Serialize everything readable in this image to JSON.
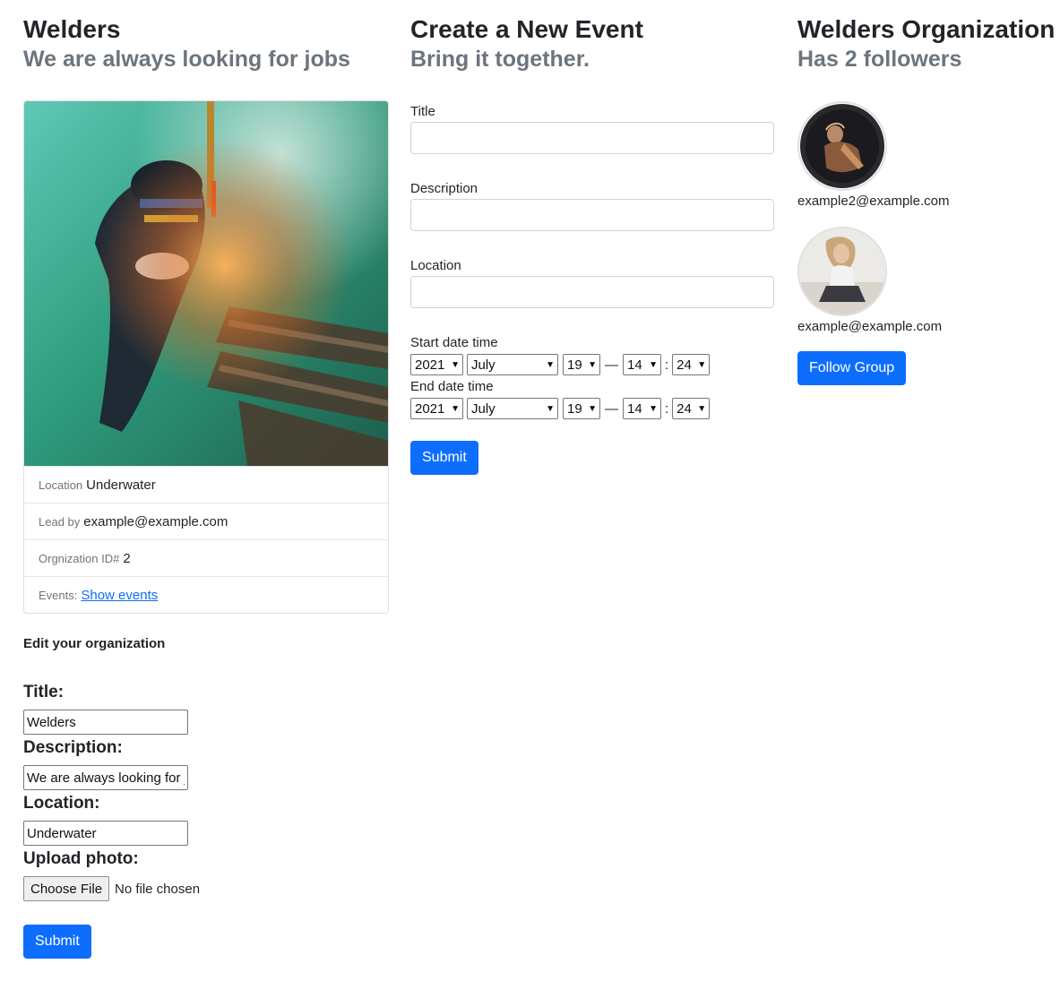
{
  "organization": {
    "title": "Welders",
    "subtitle": "We are always looking for jobs",
    "details": {
      "location_label": "Location",
      "location_value": "Underwater",
      "lead_label": "Lead by",
      "lead_value": "example@example.com",
      "org_id_label": "Orgnization ID#",
      "org_id_value": "2",
      "events_label": "Events:",
      "events_link": "Show events"
    }
  },
  "edit_form": {
    "heading": "Edit your organization",
    "title_label": "Title:",
    "title_value": "Welders",
    "description_label": "Description:",
    "description_value": "We are always looking for jobs",
    "location_label": "Location:",
    "location_value": "Underwater",
    "photo_label": "Upload photo:",
    "choose_file_label": "Choose File",
    "no_file_text": "No file chosen",
    "submit_label": "Submit"
  },
  "event_form": {
    "heading": "Create a New Event",
    "subheading": "Bring it together.",
    "title_label": "Title",
    "description_label": "Description",
    "location_label": "Location",
    "start_label": "Start date time",
    "end_label": "End date time",
    "start": {
      "year": "2021",
      "month": "July",
      "day": "19",
      "hour": "14",
      "minute": "24"
    },
    "end": {
      "year": "2021",
      "month": "July",
      "day": "19",
      "hour": "14",
      "minute": "24"
    },
    "dash": "—",
    "colon": ":",
    "submit_label": "Submit"
  },
  "group": {
    "heading": "Welders Organization",
    "followers_text": "Has 2 followers",
    "followers": [
      {
        "email": "example2@example.com"
      },
      {
        "email": "example@example.com"
      }
    ],
    "follow_label": "Follow Group"
  },
  "colors": {
    "primary": "#0d6efd",
    "muted": "#6c757d",
    "text": "#212529"
  }
}
